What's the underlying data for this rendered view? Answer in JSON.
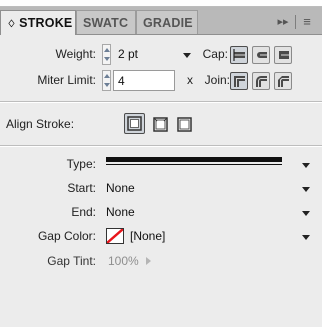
{
  "tabs": [
    {
      "label": "STROKE",
      "arrows": "♢",
      "active": true
    },
    {
      "label": "SWATC",
      "active": false
    },
    {
      "label": "GRADIE",
      "active": false
    }
  ],
  "tab_overflow": "▸▸",
  "panel_menu": "≡",
  "weight": {
    "label": "Weight:",
    "value": "2 pt"
  },
  "cap": {
    "label": "Cap:"
  },
  "miter": {
    "label": "Miter Limit:",
    "value": "4",
    "suffix": "x"
  },
  "join": {
    "label": "Join:"
  },
  "align": {
    "label": "Align Stroke:"
  },
  "type": {
    "label": "Type:"
  },
  "start": {
    "label": "Start:",
    "value": "None"
  },
  "end": {
    "label": "End:",
    "value": "None"
  },
  "gap_color": {
    "label": "Gap Color:",
    "value": "[None]"
  },
  "gap_tint": {
    "label": "Gap Tint:",
    "value": "100%"
  },
  "colors": {
    "none_swatch": "#e8151b",
    "selected_button": "#cfd4da"
  }
}
